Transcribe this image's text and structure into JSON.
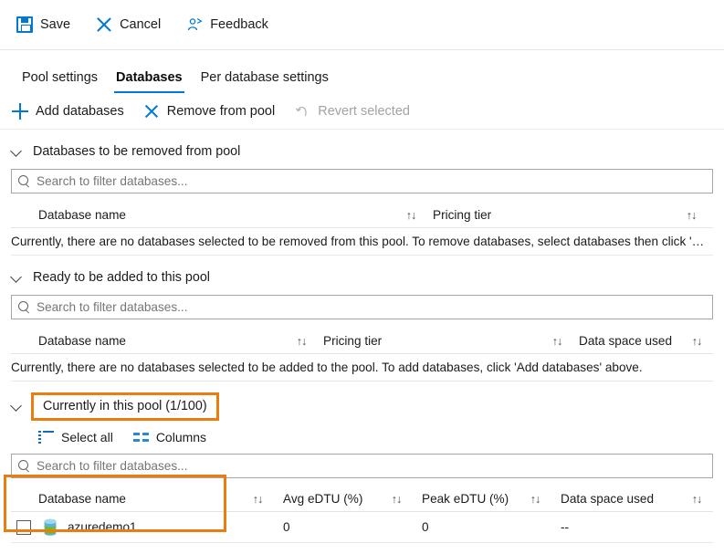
{
  "commandbar": {
    "items": [
      {
        "label": "Save",
        "icon": "save-icon",
        "enabled": true
      },
      {
        "label": "Cancel",
        "icon": "cancel-icon",
        "enabled": true
      },
      {
        "label": "Feedback",
        "icon": "feedback-icon",
        "enabled": true
      }
    ]
  },
  "tabs": [
    {
      "label": "Pool settings",
      "active": false
    },
    {
      "label": "Databases",
      "active": true
    },
    {
      "label": "Per database settings",
      "active": false
    }
  ],
  "actionbar": {
    "add_databases": "Add databases",
    "remove_from_pool": "Remove from pool",
    "revert_selected": "Revert selected"
  },
  "search": {
    "placeholder": "Search to filter databases...",
    "value": ""
  },
  "sections": {
    "removed": {
      "title": "Databases to be removed from pool",
      "columns": [
        "Database name",
        "Pricing tier"
      ],
      "empty_message": "Currently, there are no databases selected to be removed from this pool. To remove databases, select databases then click 'Re…"
    },
    "ready": {
      "title": "Ready to be added to this pool",
      "columns": [
        "Database name",
        "Pricing tier",
        "Data space used"
      ],
      "empty_message": "Currently, there are no databases selected to be added to the pool. To add databases, click 'Add databases' above."
    },
    "current": {
      "title": "Currently in this pool (1/100)",
      "highlighted": true,
      "toolbar": {
        "select_all": "Select all",
        "columns": "Columns"
      },
      "columns": [
        "Database name",
        "Avg eDTU (%)",
        "Peak eDTU (%)",
        "Data space used"
      ],
      "rows": [
        {
          "selected": false,
          "icon": "sql-database-icon",
          "name": "azuredemo1",
          "avg_edtu": "0",
          "peak_edtu": "0",
          "data_space_used": "--"
        }
      ]
    }
  },
  "icons": {
    "sort": "↑↓",
    "chevron": "chevron-down-icon"
  },
  "colors": {
    "accent": "#0078d4",
    "highlight": "#ea7d10",
    "text": "#1b1b1b",
    "disabled": "#a3a3a3",
    "border": "#e3e3e3"
  }
}
